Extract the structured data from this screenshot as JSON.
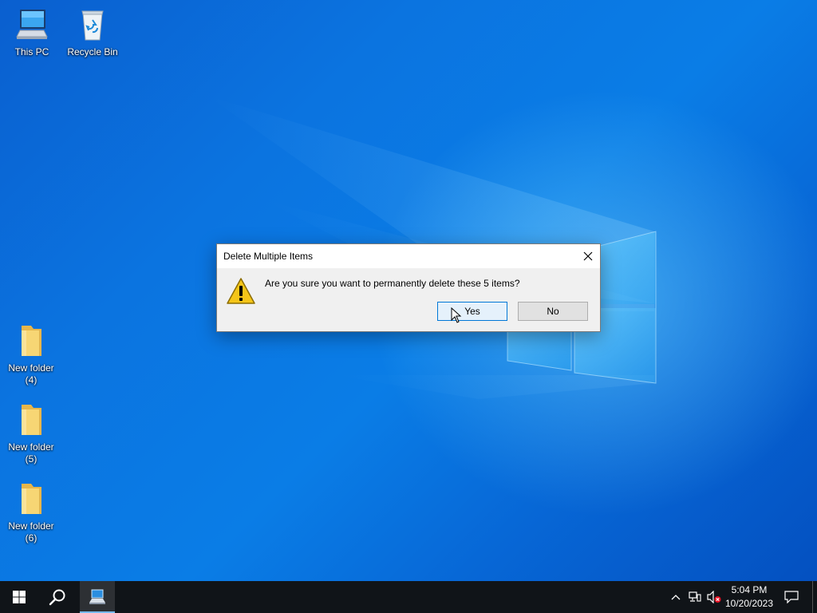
{
  "desktop": {
    "icons": [
      {
        "label": "This PC",
        "icon": "computer-icon"
      },
      {
        "label": "Recycle Bin",
        "icon": "recycle-bin-icon"
      },
      {
        "label_line1": "New folder",
        "label_line2": "(4)",
        "icon": "folder-icon"
      },
      {
        "label_line1": "New folder",
        "label_line2": "(5)",
        "icon": "folder-icon"
      },
      {
        "label_line1": "New folder",
        "label_line2": "(6)",
        "icon": "folder-icon"
      }
    ]
  },
  "dialog": {
    "title": "Delete Multiple Items",
    "message": "Are you sure you want to permanently delete these 5 items?",
    "icon": "warning-icon",
    "buttons": {
      "yes": "Yes",
      "no": "No"
    },
    "default_button": "Yes"
  },
  "taskbar": {
    "start_icon": "windows-logo-icon",
    "search_icon": "search-icon",
    "pinned_app_icon": "remote-desktop-icon",
    "tray": {
      "icons": [
        "chevron-up-icon",
        "network-icon",
        "volume-muted-icon"
      ],
      "time": "5:04 PM",
      "date": "10/20/2023",
      "notification_icon": "action-center-icon"
    }
  },
  "colors": {
    "wallpaper": "#0a74df",
    "taskbar": "#101418",
    "dialog_bg": "#f0f0f0",
    "default_button_border": "#0078d7",
    "default_button_bg": "#e5f1fb"
  }
}
